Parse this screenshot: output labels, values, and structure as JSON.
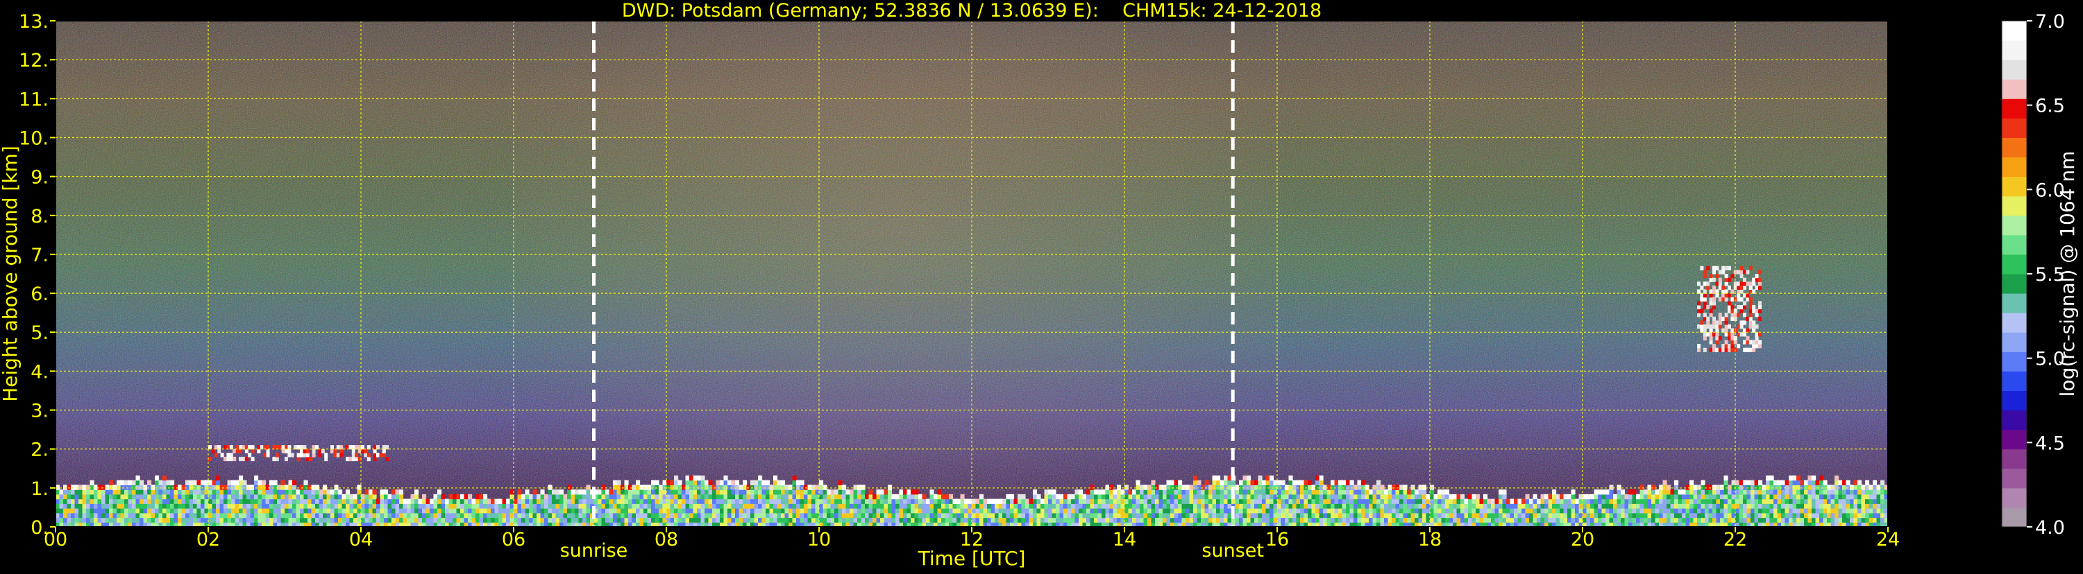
{
  "chart_data": {
    "type": "heatmap",
    "title": "DWD: Potsdam (Germany; 52.3836 N / 13.0639 E):    CHM15k: 24-12-2018",
    "xlabel": "Time [UTC]",
    "ylabel": "Height above ground [km]",
    "xlim": [
      0,
      24
    ],
    "ylim": [
      0,
      13
    ],
    "x_ticks": [
      "00",
      "02",
      "04",
      "06",
      "08",
      "10",
      "12",
      "14",
      "16",
      "18",
      "20",
      "22",
      "24"
    ],
    "y_ticks": [
      "0.",
      "1.",
      "2.",
      "3.",
      "4.",
      "5.",
      "6.",
      "7.",
      "8.",
      "9.",
      "10.",
      "11.",
      "12.",
      "13."
    ],
    "grid": true,
    "annotations": [
      {
        "label": "sunrise",
        "x": 7.05
      },
      {
        "label": "sunset",
        "x": 15.42
      }
    ],
    "colorbar": {
      "label": "log(rc-signal) @ 1064 nm",
      "range": [
        4.0,
        7.0
      ],
      "ticks": [
        "4.0",
        "4.5",
        "5.0",
        "5.5",
        "6.0",
        "6.5",
        "7.0"
      ],
      "colors": [
        "#a89aa8",
        "#b085b0",
        "#9c5a9c",
        "#8a3a8e",
        "#6a0a8a",
        "#3a0aa6",
        "#1a22d8",
        "#2a4af0",
        "#5a7cf6",
        "#8ea6f4",
        "#b4c2f4",
        "#6ac2b2",
        "#1aa04a",
        "#2ec25a",
        "#6ae08a",
        "#aaf0a0",
        "#e6f060",
        "#f4c820",
        "#f6a012",
        "#f47214",
        "#ee3216",
        "#e80808",
        "#f2c0c0",
        "#e2e2e2",
        "#f4f4f4",
        "#ffffff"
      ]
    },
    "features": [
      {
        "name": "boundary layer",
        "x_range": [
          0,
          24
        ],
        "top_km_approx": 1.0
      },
      {
        "name": "low cloud",
        "x_range": [
          2.0,
          4.4
        ],
        "height_km": [
          1.7,
          2.1
        ]
      },
      {
        "name": "high cloud",
        "x_range": [
          21.5,
          22.3
        ],
        "height_km": [
          4.5,
          6.6
        ]
      }
    ],
    "colors": {
      "axis_text": "#ffff00",
      "colorbar_text": "#ffffff",
      "grid": "#ffff00",
      "background": "#000000",
      "marker_line": "#ffffff"
    }
  }
}
